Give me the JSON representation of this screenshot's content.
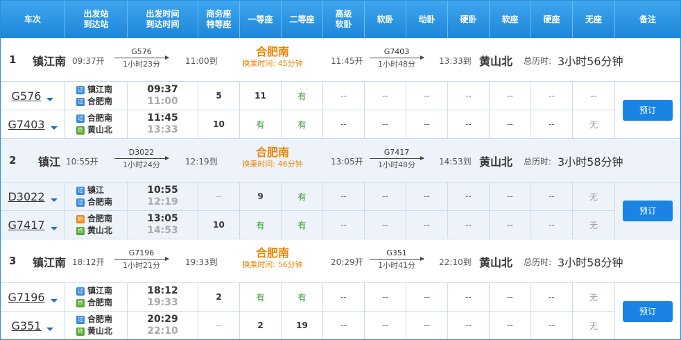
{
  "header": {
    "cols": [
      "车次",
      "出发站\n到达站",
      "出发时间\n到达时间",
      "商务座\n特等座",
      "一等座",
      "二等座",
      "高级\n软卧",
      "软卧",
      "动卧",
      "硬卧",
      "软座",
      "硬座",
      "无座",
      "备注"
    ]
  },
  "labels": {
    "book": "预订",
    "total": "总历时:",
    "wait_prefix": "换乘时间:",
    "badge_pass": "过",
    "badge_start": "始",
    "badge_end": "终"
  },
  "plans": [
    {
      "index": "1",
      "from": "镇江南",
      "dep": "09:37开",
      "seg1": {
        "code": "G576",
        "dur": "1小时23分"
      },
      "arr1": "11:00到",
      "transfer": "合肥南",
      "wait": "换乘时间: 45分钟",
      "dep2": "11:45开",
      "seg2": {
        "code": "G7403",
        "dur": "1小时48分"
      },
      "arr2": "13:33到",
      "to": "黄山北",
      "total_label": "总历时:",
      "total": "3小时56分钟",
      "trains": [
        {
          "no": "G576",
          "st1": "镇江南",
          "b1": "过",
          "st2": "合肥南",
          "b2": "过",
          "t1": "09:37",
          "t2": "11:00",
          "seats": [
            "5",
            "11",
            "有",
            "--",
            "--",
            "--",
            "--",
            "--",
            "--",
            "--"
          ]
        },
        {
          "no": "G7403",
          "st1": "合肥南",
          "b1": "过",
          "st2": "黄山北",
          "b2": "终",
          "t1": "11:45",
          "t2": "13:33",
          "seats": [
            "10",
            "有",
            "有",
            "--",
            "--",
            "--",
            "--",
            "--",
            "--",
            "无"
          ]
        }
      ]
    },
    {
      "index": "2",
      "from": "镇江",
      "dep": "10:55开",
      "seg1": {
        "code": "D3022",
        "dur": "1小时24分"
      },
      "arr1": "12:19到",
      "transfer": "合肥南",
      "wait": "换乘时间: 46分钟",
      "dep2": "13:05开",
      "seg2": {
        "code": "G7417",
        "dur": "1小时48分"
      },
      "arr2": "14:53到",
      "to": "黄山北",
      "total_label": "总历时:",
      "total": "3小时58分钟",
      "trains": [
        {
          "no": "D3022",
          "st1": "镇江",
          "b1": "过",
          "st2": "合肥南",
          "b2": "过",
          "t1": "10:55",
          "t2": "12:19",
          "seats": [
            "--",
            "9",
            "有",
            "--",
            "--",
            "--",
            "--",
            "--",
            "--",
            "无"
          ]
        },
        {
          "no": "G7417",
          "st1": "合肥南",
          "b1": "始",
          "st2": "黄山北",
          "b2": "终",
          "t1": "13:05",
          "t2": "14:53",
          "seats": [
            "10",
            "有",
            "有",
            "--",
            "--",
            "--",
            "--",
            "--",
            "--",
            "无"
          ]
        }
      ]
    },
    {
      "index": "3",
      "from": "镇江南",
      "dep": "18:12开",
      "seg1": {
        "code": "G7196",
        "dur": "1小时21分"
      },
      "arr1": "19:33到",
      "transfer": "合肥南",
      "wait": "换乘时间: 56分钟",
      "dep2": "20:29开",
      "seg2": {
        "code": "G351",
        "dur": "1小时41分"
      },
      "arr2": "22:10到",
      "to": "黄山北",
      "total_label": "总历时:",
      "total": "3小时58分钟",
      "trains": [
        {
          "no": "G7196",
          "st1": "镇江南",
          "b1": "过",
          "st2": "合肥南",
          "b2": "终",
          "t1": "18:12",
          "t2": "19:33",
          "seats": [
            "2",
            "有",
            "有",
            "--",
            "--",
            "--",
            "--",
            "--",
            "--",
            "无"
          ]
        },
        {
          "no": "G351",
          "st1": "合肥南",
          "b1": "过",
          "st2": "黄山北",
          "b2": "终",
          "t1": "20:29",
          "t2": "22:10",
          "seats": [
            "--",
            "2",
            "19",
            "--",
            "--",
            "--",
            "--",
            "--",
            "--",
            "无"
          ]
        }
      ]
    }
  ],
  "colors": {
    "header": "#1d86d9",
    "transfer": "#f08300",
    "available": "#2a9a2a",
    "button": "#1a84e4"
  }
}
